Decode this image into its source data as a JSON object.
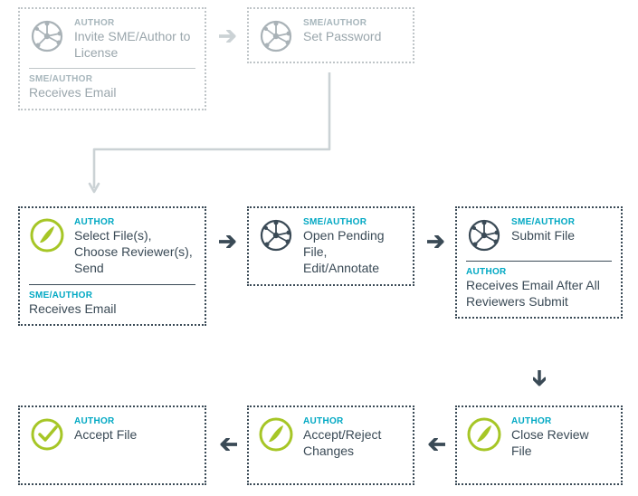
{
  "boxes": {
    "inviteLicense": {
      "role": "AUTHOR",
      "title": "Invite SME/Author to License",
      "subRole": "SME/AUTHOR",
      "subText": "Receives Email"
    },
    "setPassword": {
      "role": "SME/AUTHOR",
      "title": "Set Password"
    },
    "selectFiles": {
      "role": "AUTHOR",
      "title": "Select File(s), Choose Reviewer(s), Send",
      "subRole": "SME/AUTHOR",
      "subText": "Receives Email"
    },
    "openPending": {
      "role": "SME/AUTHOR",
      "title": "Open Pending File, Edit/Annotate"
    },
    "submitFile": {
      "role": "SME/AUTHOR",
      "title": "Submit File",
      "subRole": "AUTHOR",
      "subText": "Receives Email After All Reviewers Submit"
    },
    "closeReview": {
      "role": "AUTHOR",
      "title": "Close Review File"
    },
    "acceptReject": {
      "role": "AUTHOR",
      "title": "Accept/Reject Changes"
    },
    "acceptFile": {
      "role": "AUTHOR",
      "title": "Accept File"
    }
  }
}
